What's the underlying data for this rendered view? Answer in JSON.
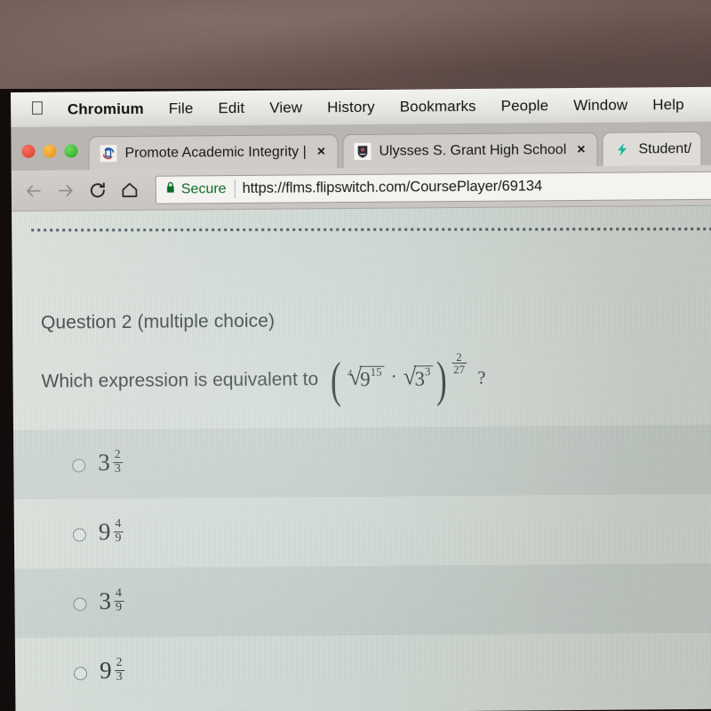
{
  "menubar": {
    "apple_icon": "apple-icon",
    "items": [
      {
        "label": "Chromium",
        "bold": true
      },
      {
        "label": "File"
      },
      {
        "label": "Edit"
      },
      {
        "label": "View"
      },
      {
        "label": "History"
      },
      {
        "label": "Bookmarks"
      },
      {
        "label": "People"
      },
      {
        "label": "Window"
      },
      {
        "label": "Help"
      }
    ]
  },
  "window_controls": {
    "close": "close-traffic-light",
    "minimize": "minimize-traffic-light",
    "zoom": "zoom-traffic-light"
  },
  "tabs": [
    {
      "title": "Promote Academic Integrity |",
      "favicon": "turnitin-favicon",
      "close_label": "×",
      "active": false
    },
    {
      "title": "Ulysses S. Grant High School",
      "favicon": "school-crest-favicon",
      "close_label": "×",
      "active": false
    },
    {
      "title": "Student/",
      "favicon": "flipswitch-bolt-favicon",
      "close_label": "",
      "active": true
    }
  ],
  "toolbar": {
    "back_icon": "back-arrow-icon",
    "forward_icon": "forward-arrow-icon",
    "reload_icon": "reload-icon",
    "home_icon": "home-icon",
    "security_label": "Secure",
    "lock_icon": "lock-icon",
    "url": "https://flms.flipswitch.com/CoursePlayer/69134"
  },
  "question": {
    "label": "Question 2 (multiple choice)",
    "prompt": "Which expression is equivalent to",
    "question_mark": "?",
    "expression": {
      "open_paren": "(",
      "close_paren": ")",
      "radical_1": {
        "index": "4",
        "radicand_base": "9",
        "radicand_exponent": "15"
      },
      "operator": "·",
      "radical_2": {
        "index": "",
        "radicand_base": "3",
        "radicand_exponent": "3"
      },
      "outer_exponent": {
        "numerator": "2",
        "denominator": "27"
      }
    }
  },
  "options": [
    {
      "base": "3",
      "numerator": "2",
      "denominator": "3",
      "selected": false,
      "banded": true
    },
    {
      "base": "9",
      "numerator": "4",
      "denominator": "9",
      "selected": false,
      "banded": false
    },
    {
      "base": "3",
      "numerator": "4",
      "denominator": "9",
      "selected": false,
      "banded": true
    },
    {
      "base": "9",
      "numerator": "2",
      "denominator": "3",
      "selected": false,
      "banded": false
    }
  ],
  "colors": {
    "page_background": "#dde7e0",
    "text": "#1e2328",
    "secure_green": "#0b6b26",
    "bezel": "#120d0c",
    "wall": "#6d5852"
  }
}
